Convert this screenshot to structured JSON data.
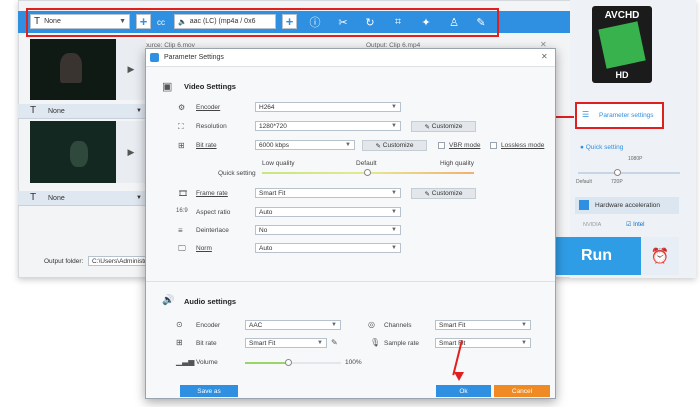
{
  "toolbar": {
    "subtitle_select": "None",
    "audio_select": "aac (LC) (mp4a / 0x6",
    "cc_label": "cc"
  },
  "clips": {
    "source_label": "Source: Clip 6.mov",
    "output_label": "Output: Clip 6.mp4",
    "subtitle_1": "None",
    "subtitle_2": "None"
  },
  "output_folder": {
    "label": "Output folder:",
    "path": "C:\\Users\\Administra"
  },
  "sidebar": {
    "format_badge": "AVCHD",
    "format_sub": "HD",
    "param_button": "Parameter settings",
    "quick_setting": "Quick setting",
    "slider_labels": {
      "left": "Default",
      "mid": "720P",
      "top": "1080P"
    },
    "hw_accel": "Hardware acceleration",
    "nvidia": "NVIDIA",
    "intel": "Intel",
    "run": "Run"
  },
  "dialog": {
    "title": "Parameter Settings",
    "video": {
      "heading": "Video Settings",
      "encoder_label": "Encoder",
      "encoder_value": "H264",
      "resolution_label": "Resolution",
      "resolution_value": "1280*720",
      "customize": "Customize",
      "bitrate_label": "Bit rate",
      "bitrate_value": "6000 kbps",
      "vbr_label": "VBR mode",
      "lossless_label": "Lossless mode",
      "quality_low": "Low quality",
      "quality_default": "Default",
      "quality_high": "High quality",
      "quick_setting": "Quick setting",
      "framerate_label": "Frame rate",
      "framerate_value": "Smart Fit",
      "aspect_label": "Aspect ratio",
      "aspect_value": "Auto",
      "deinterlace_label": "Deinterlace",
      "deinterlace_value": "No",
      "norm_label": "Norm",
      "norm_value": "Auto"
    },
    "audio": {
      "heading": "Audio settings",
      "encoder_label": "Encoder",
      "encoder_value": "AAC",
      "channels_label": "Channels",
      "channels_value": "Smart Fit",
      "bitrate_label": "Bit rate",
      "bitrate_value": "Smart Fit",
      "samplerate_label": "Sample rate",
      "samplerate_value": "Smart Fit",
      "volume_label": "Volume",
      "volume_value": "100%",
      "volume_level": 0.45
    },
    "footer": {
      "save_as": "Save as",
      "ok": "Ok",
      "cancel": "Cancel"
    }
  },
  "colors": {
    "accent": "#2f8fe0",
    "highlight": "#e0201e",
    "ok": "#2f8fe0",
    "cancel": "#f08a24"
  }
}
